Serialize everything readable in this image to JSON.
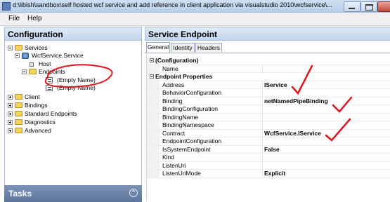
{
  "window": {
    "title": "d:\\libish\\sandbox\\self hosted wcf service and add reference in client application via visualstudio 2010\\wcfservice\\..."
  },
  "menu": {
    "file": "File",
    "help": "Help"
  },
  "left": {
    "header": "Configuration",
    "tree": {
      "services": "Services",
      "service": "WcfService.Service",
      "host": "Host",
      "endpoints": "Endpoints",
      "endpoint1": "(Empty Name)",
      "endpoint2": "(Empty Name)",
      "client": "Client",
      "bindings": "Bindings",
      "standard_endpoints": "Standard Endpoints",
      "diagnostics": "Diagnostics",
      "advanced": "Advanced"
    },
    "tasks": "Tasks",
    "annotation_color": "#e0141e"
  },
  "right": {
    "header": "Service Endpoint",
    "tabs": [
      "General",
      "Identity",
      "Headers"
    ],
    "grid": {
      "cat_configuration": "(Configuration)",
      "name": "Name",
      "cat_endpoint_props": "Endpoint Properties",
      "address": "Address",
      "address_value": "IService",
      "behavior_configuration": "BehaviorConfiguration",
      "binding": "Binding",
      "binding_value": "netNamedPipeBinding",
      "binding_configuration": "BindingConfiguration",
      "binding_name": "BindingName",
      "binding_namespace": "BindingNamespace",
      "contract": "Contract",
      "contract_value": "WcfService.IService",
      "endpoint_configuration": "EndpointConfiguration",
      "is_system_endpoint": "IsSystemEndpoint",
      "is_system_endpoint_value": "False",
      "kind": "Kind",
      "listen_uri": "ListenUri",
      "listen_uri_mode": "ListenUriMode",
      "listen_uri_mode_value": "Explicit"
    }
  }
}
